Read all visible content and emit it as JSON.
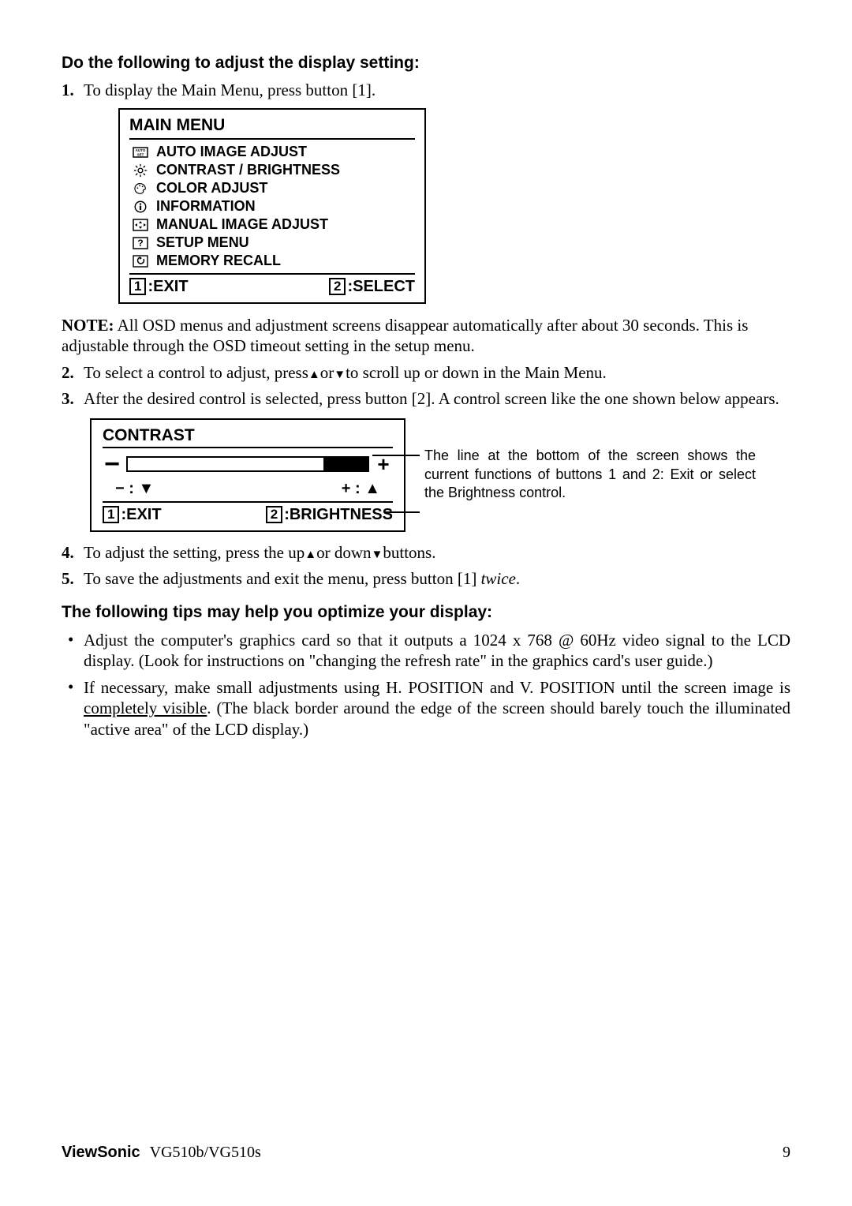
{
  "heading1": "Do the following to adjust the display setting:",
  "step1_num": "1.",
  "step1_text": "To display the Main Menu, press button [1].",
  "main_menu": {
    "title": "MAIN MENU",
    "items": [
      "AUTO IMAGE ADJUST",
      "CONTRAST / BRIGHTNESS",
      "COLOR ADJUST",
      "INFORMATION",
      "MANUAL IMAGE ADJUST",
      "SETUP MENU",
      "MEMORY RECALL"
    ],
    "footer_left_key": "1",
    "footer_left_label": ":EXIT",
    "footer_right_key": "2",
    "footer_right_label": ":SELECT"
  },
  "note_label": "NOTE:",
  "note_text": " All OSD menus and adjustment screens disappear automatically after about 30 seconds. This is adjustable through the OSD timeout setting in the setup menu.",
  "step2_num": "2.",
  "step2_a": "To select a control to adjust, press",
  "step2_b": "or",
  "step2_c": "to scroll up or down in the Main Menu.",
  "step3_num": "3.",
  "step3_text": "After the desired control is selected, press button [2]. A control screen like the one shown below appears.",
  "contrast": {
    "title": "CONTRAST",
    "minus_label": "− : ▼",
    "plus_label": "+ : ▲",
    "footer_left_key": "1",
    "footer_left_label": ":EXIT",
    "footer_right_key": "2",
    "footer_right_label": ":BRIGHTNESS"
  },
  "caption_text": "The line at the bottom of the screen shows the current functions of buttons 1 and 2:  Exit or select the Brightness control.",
  "step4_num": "4.",
  "step4_a": "To adjust the setting, press the up",
  "step4_b": "or down",
  "step4_c": "buttons.",
  "step5_num": "5.",
  "step5_a": "To save the adjustments and exit the menu, press button [1] ",
  "step5_b": "twice",
  "step5_c": ".",
  "heading2": "The following tips may help you optimize your display:",
  "tip1": "Adjust the computer's graphics card so that it outputs a 1024 x 768 @ 60Hz video signal to the LCD display. (Look for instructions on \"changing the refresh rate\" in the graphics card's user guide.)",
  "tip2_a": "If necessary, make small adjustments using H. POSITION and V. POSITION until the screen image is ",
  "tip2_b": "completely visible",
  "tip2_c": ". (The black border around the edge of the screen should barely touch the illuminated \"active area\" of the LCD display.)",
  "footer_brand": "ViewSonic",
  "footer_model": "VG510b/VG510s",
  "footer_page": "9"
}
